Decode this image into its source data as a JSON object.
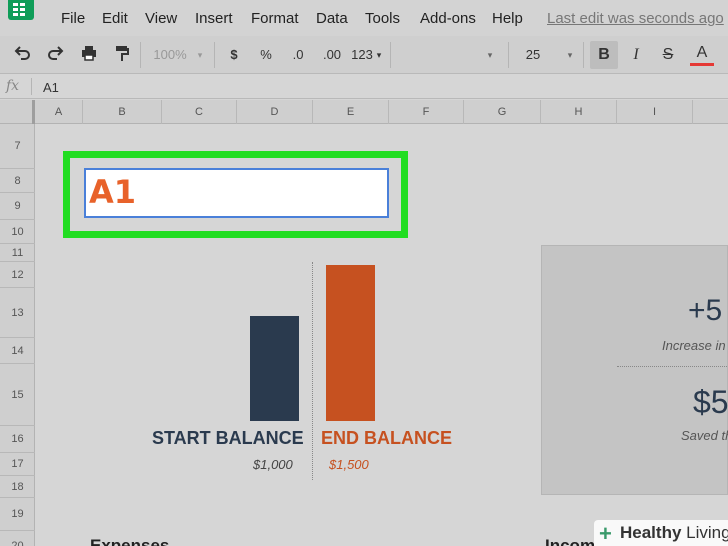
{
  "menu": {
    "items": [
      "File",
      "Edit",
      "View",
      "Insert",
      "Format",
      "Data",
      "Tools",
      "Add-ons",
      "Help"
    ],
    "last_edit": "Last edit was seconds ago"
  },
  "toolbar": {
    "zoom": "100%",
    "currency": "$",
    "percent": "%",
    "decrease_decimals": ".0",
    "increase_decimals": ".00",
    "more_formats": "123",
    "font_size": "25",
    "bold": "B",
    "italic": "I",
    "strikethrough": "S",
    "text_color": "A",
    "icons": [
      "undo-icon",
      "redo-icon",
      "print-icon",
      "paint-format-icon"
    ]
  },
  "formula_bar": {
    "fx": "fx",
    "value": "A1"
  },
  "columns": [
    "A",
    "B",
    "C",
    "D",
    "E",
    "F",
    "G",
    "H",
    "I"
  ],
  "rows": [
    "7",
    "8",
    "9",
    "10",
    "11",
    "12",
    "13",
    "14",
    "15",
    "16",
    "17",
    "18",
    "19",
    "20"
  ],
  "name_box": {
    "value": "A1"
  },
  "chart": {
    "start_label": "START BALANCE",
    "end_label": "END BALANCE",
    "start_value": "$1,000",
    "end_value": "$1,500"
  },
  "chart_data": {
    "type": "bar",
    "categories": [
      "START BALANCE",
      "END BALANCE"
    ],
    "values": [
      1000,
      1500
    ],
    "colors": [
      "#2a3a4e",
      "#c65120"
    ]
  },
  "summary_card": {
    "big1": "+5",
    "sub1": "Increase in",
    "big2": "$5",
    "sub2": "Saved th"
  },
  "bottom": {
    "left": "Expenses",
    "right": "Incom"
  },
  "watermark": {
    "plus": "+",
    "brand": "Healthy",
    "brand_light": "Living"
  },
  "colors": {
    "highlight_green": "#22dd22",
    "name_box_text": "#e8622a",
    "start_bar": "#2a3a4e",
    "end_bar": "#c65120",
    "sheets_green": "#0f9d58"
  }
}
